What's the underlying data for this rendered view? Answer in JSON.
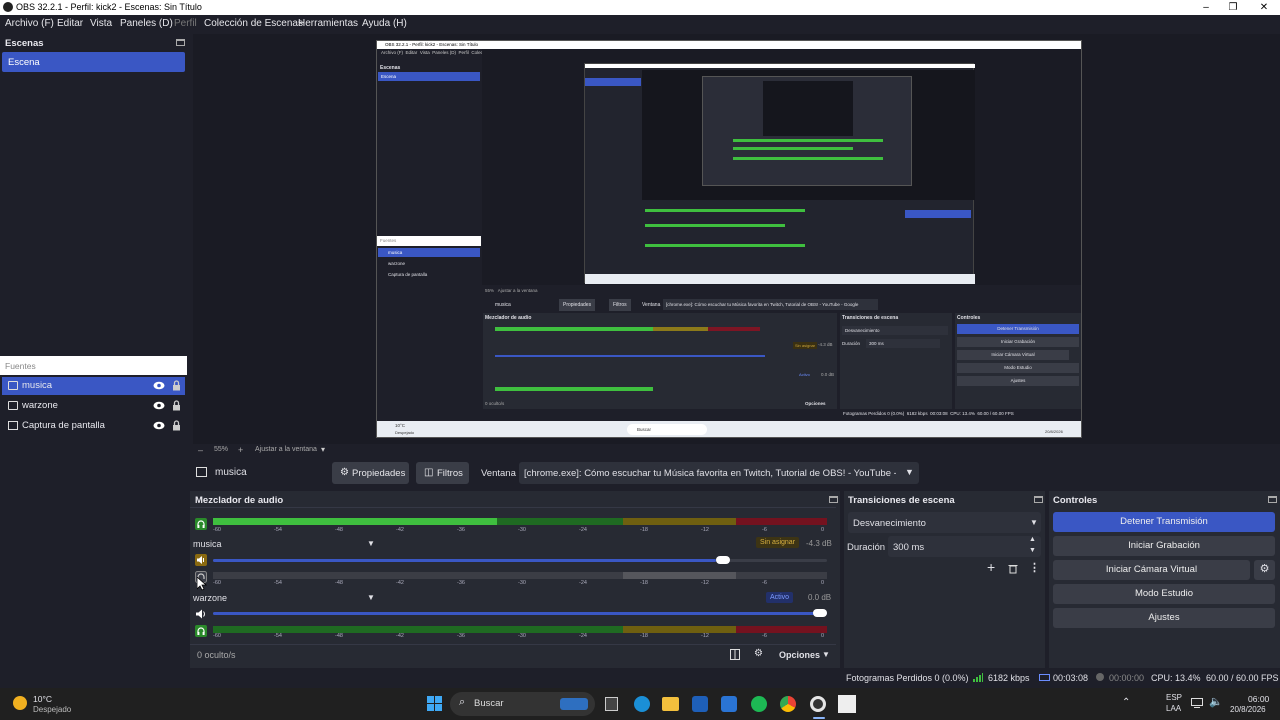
{
  "window": {
    "title": "OBS 32.2.1 - Perfil: kick2 - Escenas: Sin Título",
    "minimize": "–",
    "maximize": "❐",
    "close": "✕"
  },
  "menu": [
    "Archivo (F)",
    "Editar",
    "Vista",
    "Paneles (D)",
    "Perfil",
    "Colección de Escenas",
    "Herramientas",
    "Ayuda (H)"
  ],
  "scenes": {
    "title": "Escenas",
    "items": [
      "Escena"
    ]
  },
  "sources": {
    "title": "Fuentes",
    "items": [
      "musica",
      "warzone",
      "Captura de pantalla"
    ]
  },
  "preview": {
    "zoom": "55%",
    "fit": "Ajustar a la ventana",
    "inner": {
      "title": "OBS 32.2.1 - Perfil: kick2 - Escenas: Sin Título",
      "menu": [
        "Archivo (F)",
        "Editar",
        "Vista",
        "Paneles (D)",
        "Perfil",
        "Colección de Escenas",
        "Herramientas",
        "Ayuda (H)"
      ],
      "scenes_title": "Escenas",
      "scene_item": "Escena",
      "sources_title": "Fuentes",
      "sources": [
        "musica",
        "warzone",
        "Captura de pantalla"
      ],
      "zoom": "55%",
      "fit": "Ajustar a la ventana",
      "source_name": "musica",
      "props": "Propiedades",
      "filters": "Filtros",
      "window_label": "Ventana",
      "window_value": "[chrome.exe]: Cómo escuchar tu Música favorita en Twitch, Tutorial de OBS! - YouTube - Google",
      "mixer_title": "Mezclador de audio",
      "unassigned": "Sin asignar",
      "db1": "-4.3 dB",
      "active": "Activo",
      "db2": "0.0 dB",
      "hidden": "0 oculto/s",
      "options": "Opciones",
      "trans_title": "Transiciones de escena",
      "trans_value": "Desvanecimiento",
      "dur_label": "Duración",
      "dur_value": "300 ms",
      "controls_title": "Controles",
      "controls": [
        "Detener Transmisión",
        "Iniciar Grabación",
        "Iniciar Cámara Virtual",
        "Modo Estudio",
        "Ajustes"
      ],
      "status": "Fotogramas Perdidos 0 (0.0%)",
      "kbps": "6182 kbps",
      "time": "00:03:08",
      "cpu": "CPU: 13.4%",
      "fps": "60.00 / 60.00 FPS",
      "weather_temp": "10°C",
      "weather_desc": "Despejado",
      "search": "Buscar",
      "date": "20/8/2026"
    }
  },
  "source_toolbar": {
    "name": "musica",
    "properties": "Propiedades",
    "filters": "Filtros",
    "window_label": "Ventana",
    "window_value": "[chrome.exe]: Cómo escuchar tu Música favorita en Twitch, Tutorial de OBS! - YouTube - Google"
  },
  "mixer": {
    "title": "Mezclador de audio",
    "ticks": [
      "-60",
      "-54",
      "-48",
      "-42",
      "-36",
      "-30",
      "-24",
      "-18",
      "-12",
      "-6",
      "0"
    ],
    "channels": [
      {
        "name": "musica",
        "badge": "Sin asignar",
        "db": "-4.3 dB",
        "volume": 0.82
      },
      {
        "name": "warzone",
        "badge": "Activo",
        "db": "0.0 dB",
        "volume": 1.0
      }
    ],
    "hidden": "0 oculto/s",
    "options": "Opciones"
  },
  "transitions": {
    "title": "Transiciones de escena",
    "value": "Desvanecimiento",
    "duration_label": "Duración",
    "duration_value": "300 ms"
  },
  "controls": {
    "title": "Controles",
    "buttons": [
      "Detener Transmisión",
      "Iniciar Grabación",
      "Iniciar Cámara Virtual",
      "Modo Estudio",
      "Ajustes"
    ]
  },
  "status": {
    "dropped": "Fotogramas Perdidos 0 (0.0%)",
    "kbps": "6182 kbps",
    "stream_time": "00:03:08",
    "rec_time": "00:00:00",
    "cpu": "CPU: 13.4%",
    "fps": "60.00 / 60.00 FPS"
  },
  "taskbar": {
    "temp": "10°C",
    "weather": "Despejado",
    "search": "Buscar",
    "lang1": "ESP",
    "lang2": "LAA",
    "time": "06:00",
    "date": "20/8/2026"
  },
  "colors": {
    "accent": "#3a57c4",
    "meter_green": "#3fbf3f",
    "meter_yellow": "#b59a1e",
    "meter_red": "#a3182b"
  }
}
